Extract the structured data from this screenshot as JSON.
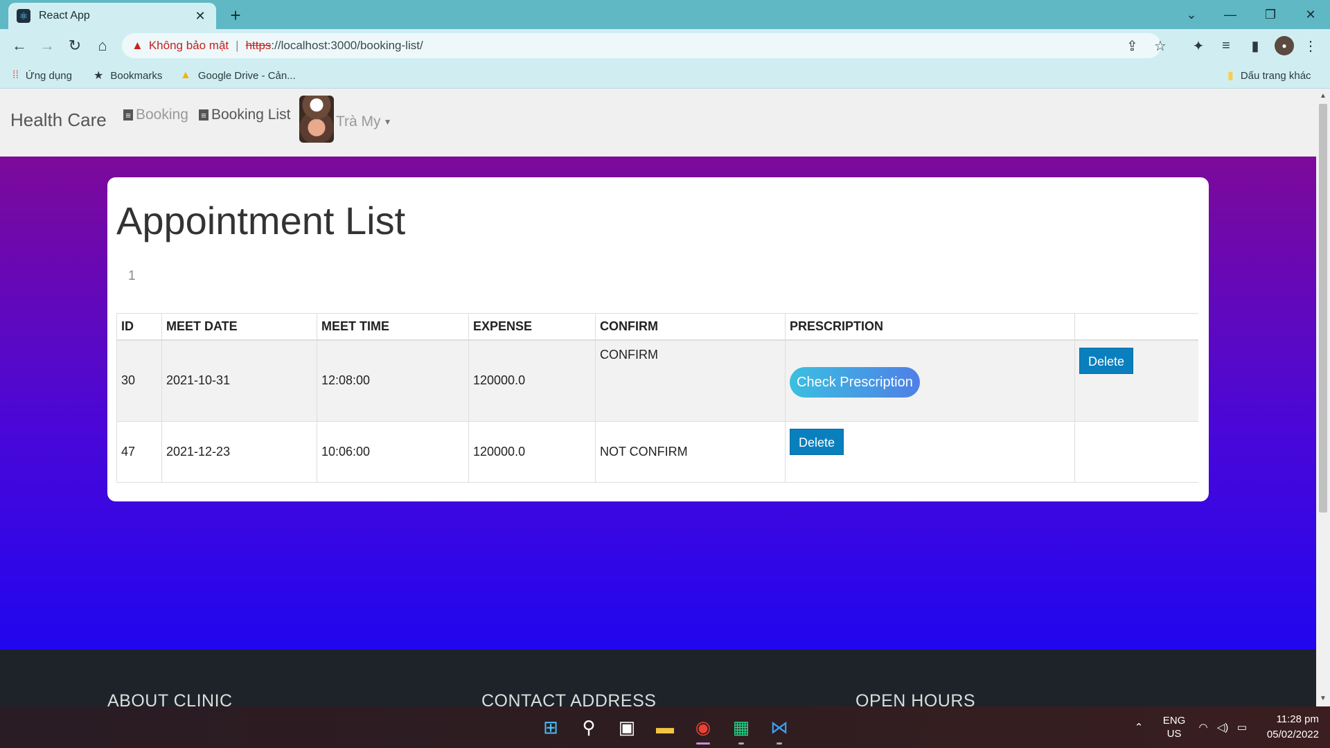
{
  "browser": {
    "tab_title": "React App",
    "security_label": "Không bảo mật",
    "url_scheme": "https",
    "url_rest": "://localhost:3000/booking-list/",
    "bookmarks": [
      {
        "label": "Ứng dụng",
        "icon": "apps-grid-icon"
      },
      {
        "label": "Bookmarks",
        "icon": "star-icon"
      },
      {
        "label": "Google Drive - Cản...",
        "icon": "google-drive-icon"
      }
    ],
    "other_bookmarks": "Dấu trang khác"
  },
  "navbar": {
    "brand": "Health Care",
    "links": [
      {
        "label": "Booking",
        "color": "#999999"
      },
      {
        "label": "Booking List",
        "color": "#555555"
      }
    ],
    "user_name": "Trà My"
  },
  "main": {
    "title": "Appointment List",
    "page_number": "1",
    "columns": [
      "ID",
      "MEET DATE",
      "MEET TIME",
      "EXPENSE",
      "CONFIRM",
      "PRESCRIPTION",
      ""
    ],
    "rows": [
      {
        "id": "30",
        "meet_date": "2021-10-31",
        "meet_time": "12:08:00",
        "expense": "120000.0",
        "confirm": "CONFIRM",
        "prescription_button": "Check Prescription",
        "delete_button": "Delete"
      },
      {
        "id": "47",
        "meet_date": "2021-12-23",
        "meet_time": "10:06:00",
        "expense": "120000.0",
        "confirm": "NOT CONFIRM",
        "delete_button": "Delete"
      }
    ]
  },
  "footer": {
    "columns": [
      "ABOUT CLINIC",
      "CONTACT ADDRESS",
      "OPEN HOURS"
    ]
  },
  "taskbar": {
    "language": "ENG",
    "region": "US",
    "time": "11:28 pm",
    "date": "05/02/2022"
  },
  "colors": {
    "gradient_top": "#8a0a8a",
    "gradient_bottom": "#1606f5",
    "delete_button": "#0a7fbd",
    "prescription_button": "#3bbfe0",
    "tab_bar": "#5fb8c3"
  }
}
